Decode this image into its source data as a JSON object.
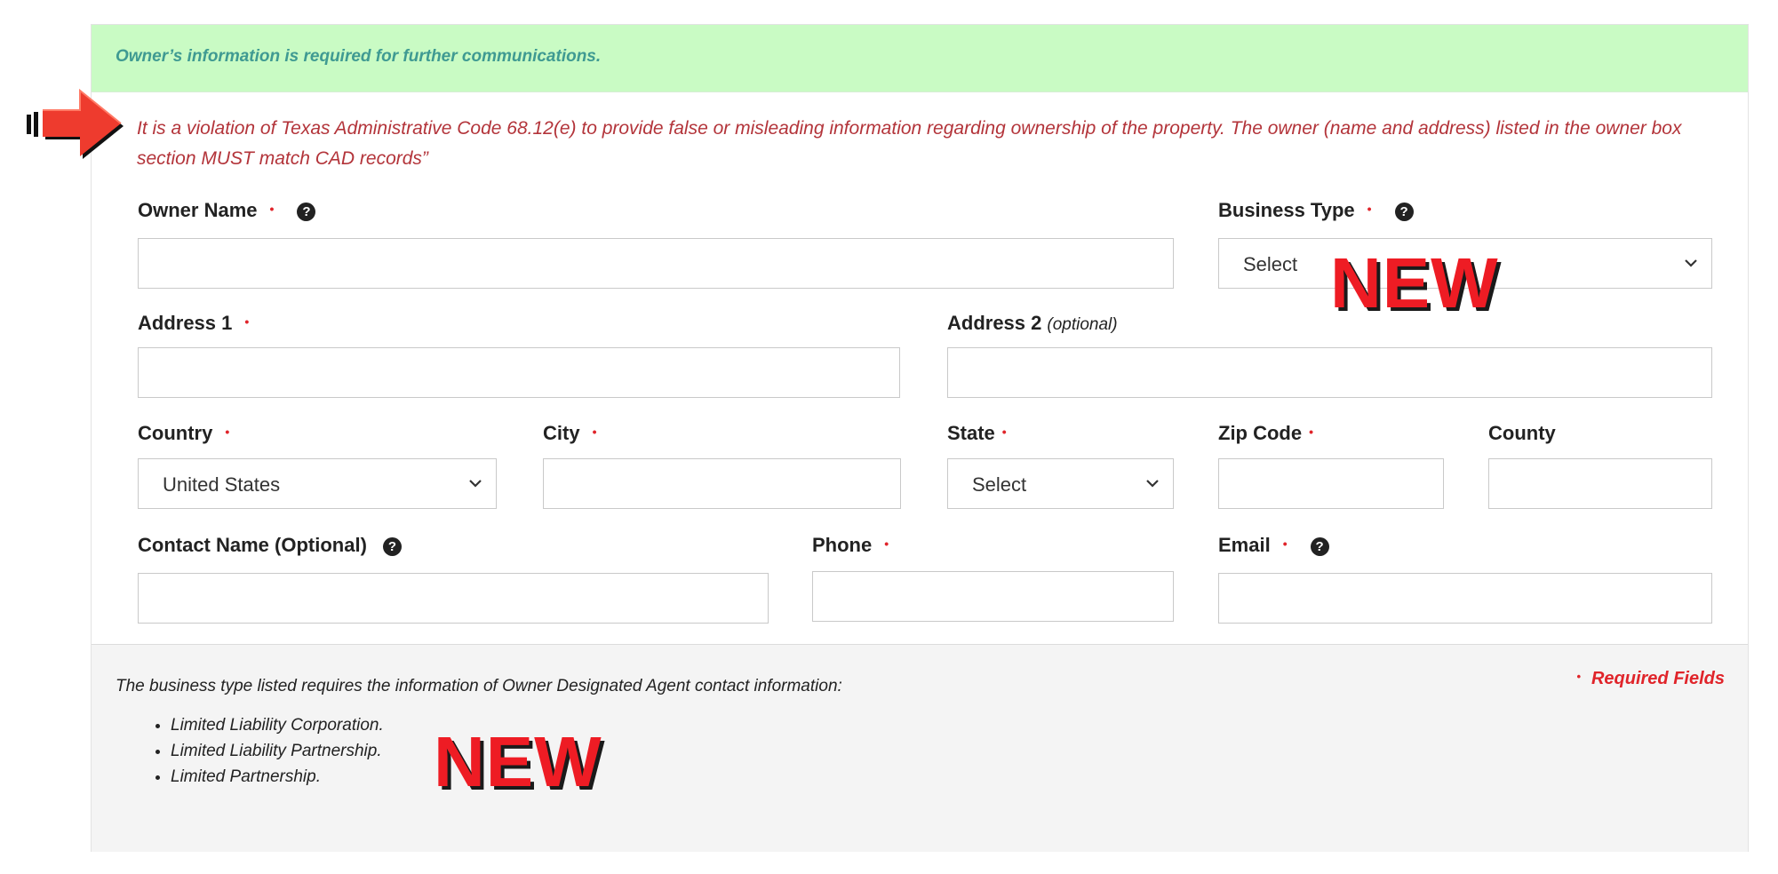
{
  "banner": {
    "text": "Owner’s information is required for further communications."
  },
  "violation": {
    "text": "It is a violation of Texas Administrative Code 68.12(e) to provide false or misleading information regarding ownership of the property. The owner (name and address) listed in the owner box section MUST match CAD records”"
  },
  "form": {
    "required_marker": "•",
    "help_glyph": "?",
    "owner_name": {
      "label": "Owner Name",
      "value": ""
    },
    "business_type": {
      "label": "Business Type",
      "value": "Select"
    },
    "address1": {
      "label": "Address 1",
      "value": ""
    },
    "address2": {
      "label": "Address 2",
      "optional": "(optional)",
      "value": ""
    },
    "country": {
      "label": "Country",
      "value": "United States"
    },
    "city": {
      "label": "City",
      "value": ""
    },
    "state": {
      "label": "State",
      "value": "Select"
    },
    "zip": {
      "label": "Zip Code",
      "value": ""
    },
    "county": {
      "label": "County",
      "value": ""
    },
    "contact_name": {
      "label": "Contact Name (Optional)",
      "value": ""
    },
    "phone": {
      "label": "Phone",
      "value": ""
    },
    "email": {
      "label": "Email",
      "value": ""
    }
  },
  "annotations": {
    "new_badge": "NEW"
  },
  "footer": {
    "text": "The business type listed requires the information of Owner Designated Agent contact information:",
    "items": [
      "Limited Liability Corporation.",
      "Limited Liability Partnership.",
      "Limited Partnership."
    ],
    "required_fields": "Required Fields"
  },
  "colors": {
    "banner_bg": "#c9fbc4",
    "banner_text": "#3f9a92",
    "violation_text": "#b3343a",
    "required": "#e0242a",
    "badge": "#ee1c24"
  }
}
